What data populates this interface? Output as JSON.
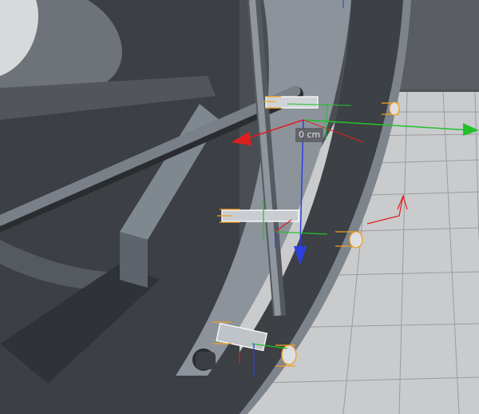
{
  "viewport": {
    "coordinate_readout": "0 cm"
  },
  "colors": {
    "background": "#4a4d52",
    "floor": "#c9cbcd",
    "grid_line": "#9a9c9e",
    "hull_dark": "#3c3f44",
    "hull_mid": "#6e737a",
    "hull_light": "#9aa1a8",
    "axis_x": "#e01f1f",
    "axis_y": "#22c12b",
    "axis_z": "#2d3fe0",
    "selection_orange": "#f0a020"
  },
  "gizmo": {
    "x_axis_icon": "arrow-x-icon",
    "y_axis_icon": "arrow-y-icon",
    "z_axis_icon": "arrow-z-icon"
  }
}
